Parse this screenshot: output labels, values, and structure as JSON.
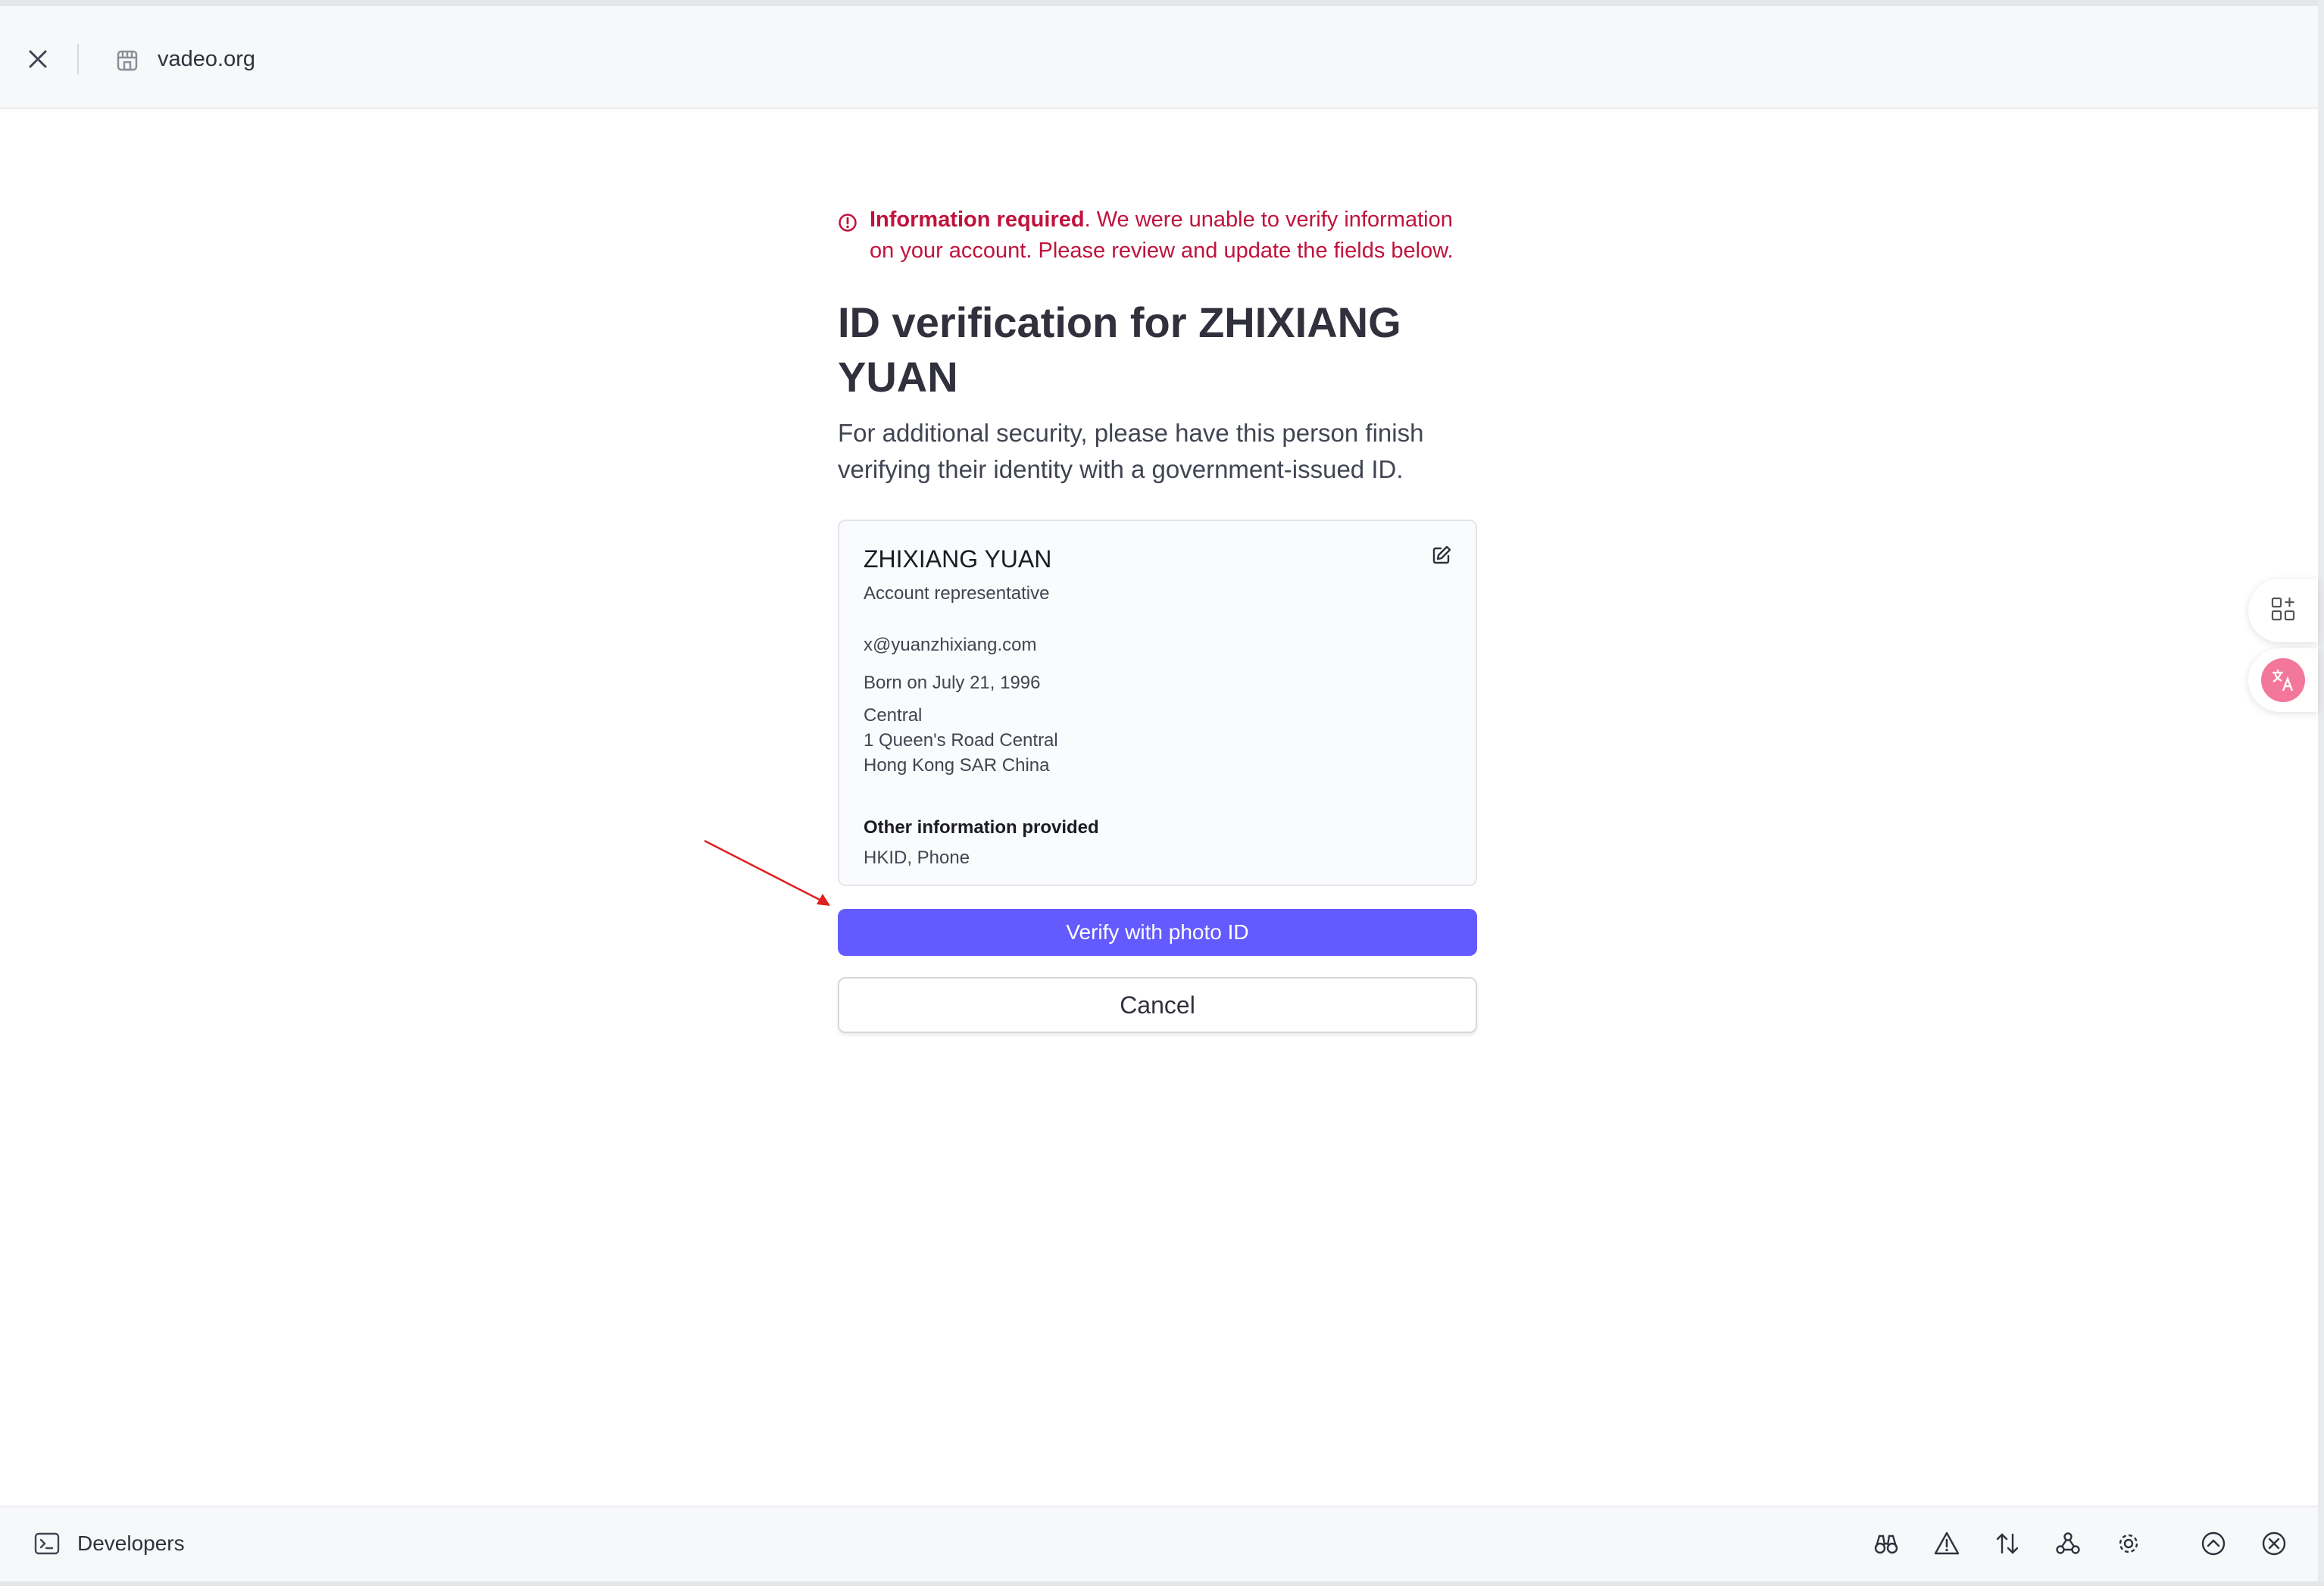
{
  "browser": {
    "site_name": "vadeo.org"
  },
  "alert": {
    "bold": "Information required",
    "message": ". We were unable to verify information on your account. Please review and update the fields below."
  },
  "page": {
    "title": "ID verification for ZHIXIANG YUAN",
    "subtitle": "For additional security, please have this person finish verifying their identity with a government-issued ID."
  },
  "person": {
    "name": "ZHIXIANG YUAN",
    "role": "Account representative",
    "email": "x@yuanzhixiang.com",
    "dob": "Born on July 21, 1996",
    "address": [
      "Central",
      "1 Queen's Road Central",
      "Hong Kong SAR China"
    ],
    "other_label": "Other information provided",
    "other_value": "HKID, Phone"
  },
  "actions": {
    "verify_label": "Verify with photo ID",
    "cancel_label": "Cancel"
  },
  "devbar": {
    "label": "Developers",
    "tools": [
      "binoculars-icon",
      "warning-icon",
      "sort-arrows-icon",
      "webhook-icon",
      "settings-icon",
      "collapse-up-icon",
      "close-circle-icon"
    ]
  },
  "colors": {
    "primary": "#635bff",
    "alert": "#c0123c",
    "annotation_arrow": "#e02020",
    "translate_badge": "#f2779a"
  },
  "side_widgets": [
    "add-widget-icon",
    "translate-icon"
  ]
}
